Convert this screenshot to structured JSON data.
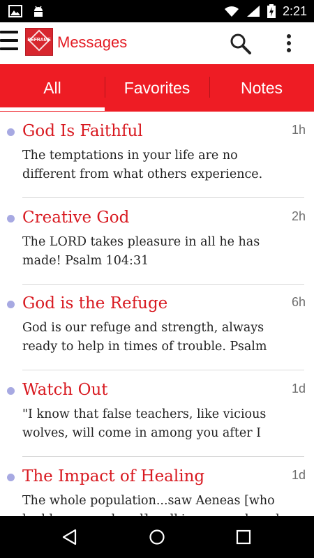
{
  "status_bar": {
    "time": "2:21",
    "icons": [
      "image-icon",
      "android-icon",
      "wifi-icon",
      "signal-icon",
      "battery-charging-icon"
    ]
  },
  "app_bar": {
    "logo_text": "REFRAME",
    "title": "Messages",
    "icons": [
      "menu-icon",
      "search-icon",
      "overflow-menu-icon"
    ]
  },
  "tabs": [
    {
      "label": "All",
      "selected": true
    },
    {
      "label": "Favorites",
      "selected": false
    },
    {
      "label": "Notes",
      "selected": false
    }
  ],
  "colors": {
    "accent": "#ee1c24",
    "title_red": "#d81920",
    "unread_dot": "#a7a9e2"
  },
  "messages": [
    {
      "title": "God Is Faithful",
      "time": "1h",
      "snippet": "The temptations in your life are no different from what others experience."
    },
    {
      "title": "Creative God",
      "time": "2h",
      "snippet": "The LORD takes pleasure in all he has made! Psalm 104:31"
    },
    {
      "title": "God is the Refuge",
      "time": "6h",
      "snippet": "God is our refuge and strength, always ready to help in times of trouble. Psalm"
    },
    {
      "title": "Watch Out",
      "time": "1d",
      "snippet": "\"I know that false teachers, like vicious wolves, will come in among you after I"
    },
    {
      "title": "The Impact of Healing",
      "time": "1d",
      "snippet": "The whole population...saw Aeneas [who had been paralyzed] walking around, and"
    }
  ],
  "nav_bar": {
    "icons": [
      "back-icon",
      "home-icon",
      "recents-icon"
    ]
  }
}
